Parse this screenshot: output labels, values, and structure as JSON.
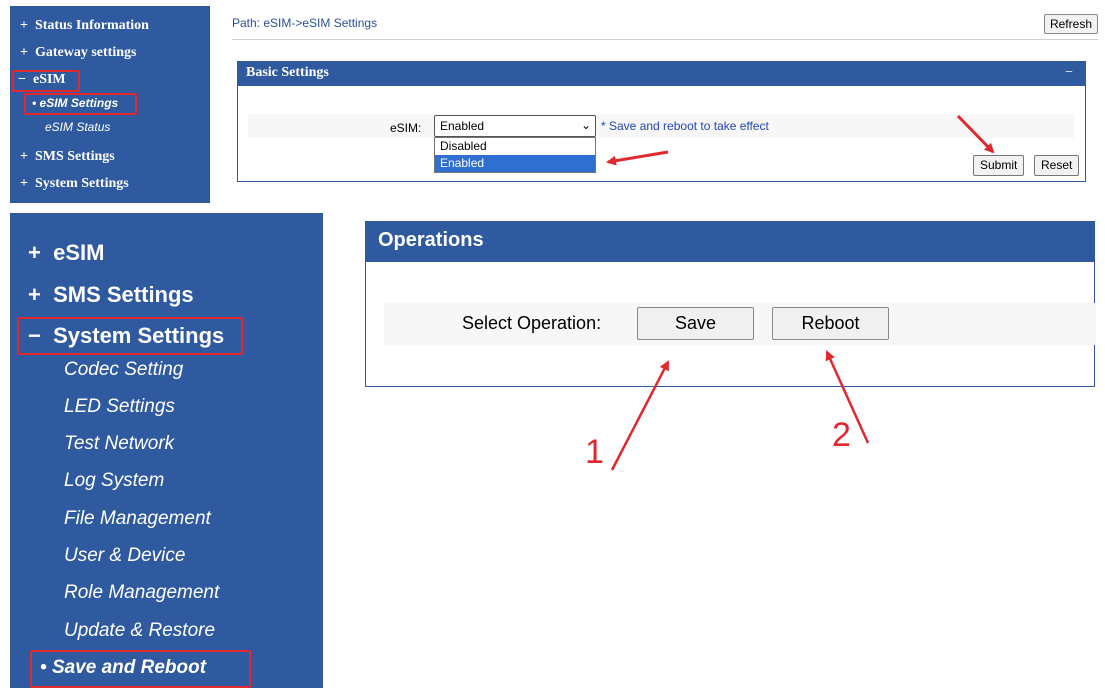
{
  "top": {
    "sidebar": {
      "items": [
        {
          "prefix": "+",
          "label": "Status Information"
        },
        {
          "prefix": "+",
          "label": "Gateway settings"
        },
        {
          "prefix": "−",
          "label": "eSIM"
        },
        {
          "prefix": "•",
          "label": "eSIM Settings"
        },
        {
          "prefix": "",
          "label": "eSIM Status"
        },
        {
          "prefix": "+",
          "label": "SMS Settings"
        },
        {
          "prefix": "+",
          "label": "System Settings"
        }
      ]
    },
    "path": "Path: eSIM->eSIM Settings",
    "refresh_label": "Refresh",
    "panel_title": "Basic Settings",
    "panel_collapse": "−",
    "esim_label": "eSIM:",
    "esim_value": "Enabled",
    "esim_options": [
      "Disabled",
      "Enabled"
    ],
    "hint": "* Save and reboot to take effect",
    "submit_label": "Submit",
    "reset_label": "Reset"
  },
  "bottom": {
    "sidebar": {
      "items": [
        {
          "prefix": "+",
          "label": "eSIM"
        },
        {
          "prefix": "+",
          "label": "SMS Settings"
        },
        {
          "prefix": "−",
          "label": "System Settings"
        },
        {
          "prefix": "",
          "label": "Codec Setting"
        },
        {
          "prefix": "",
          "label": "LED Settings"
        },
        {
          "prefix": "",
          "label": "Test Network"
        },
        {
          "prefix": "",
          "label": "Log System"
        },
        {
          "prefix": "",
          "label": "File Management"
        },
        {
          "prefix": "",
          "label": "User & Device"
        },
        {
          "prefix": "",
          "label": "Role Management"
        },
        {
          "prefix": "",
          "label": "Update & Restore"
        },
        {
          "prefix": "•",
          "label": "Save and Reboot"
        }
      ]
    },
    "panel_title": "Operations",
    "select_label": "Select Operation:",
    "save_label": "Save",
    "reboot_label": "Reboot"
  },
  "annotations": {
    "step1": "1",
    "step2": "2"
  },
  "colors": {
    "sidebar_bg": "#2f5aa0",
    "annotation_red": "#e0282e",
    "hint_blue": "#2446b8"
  }
}
